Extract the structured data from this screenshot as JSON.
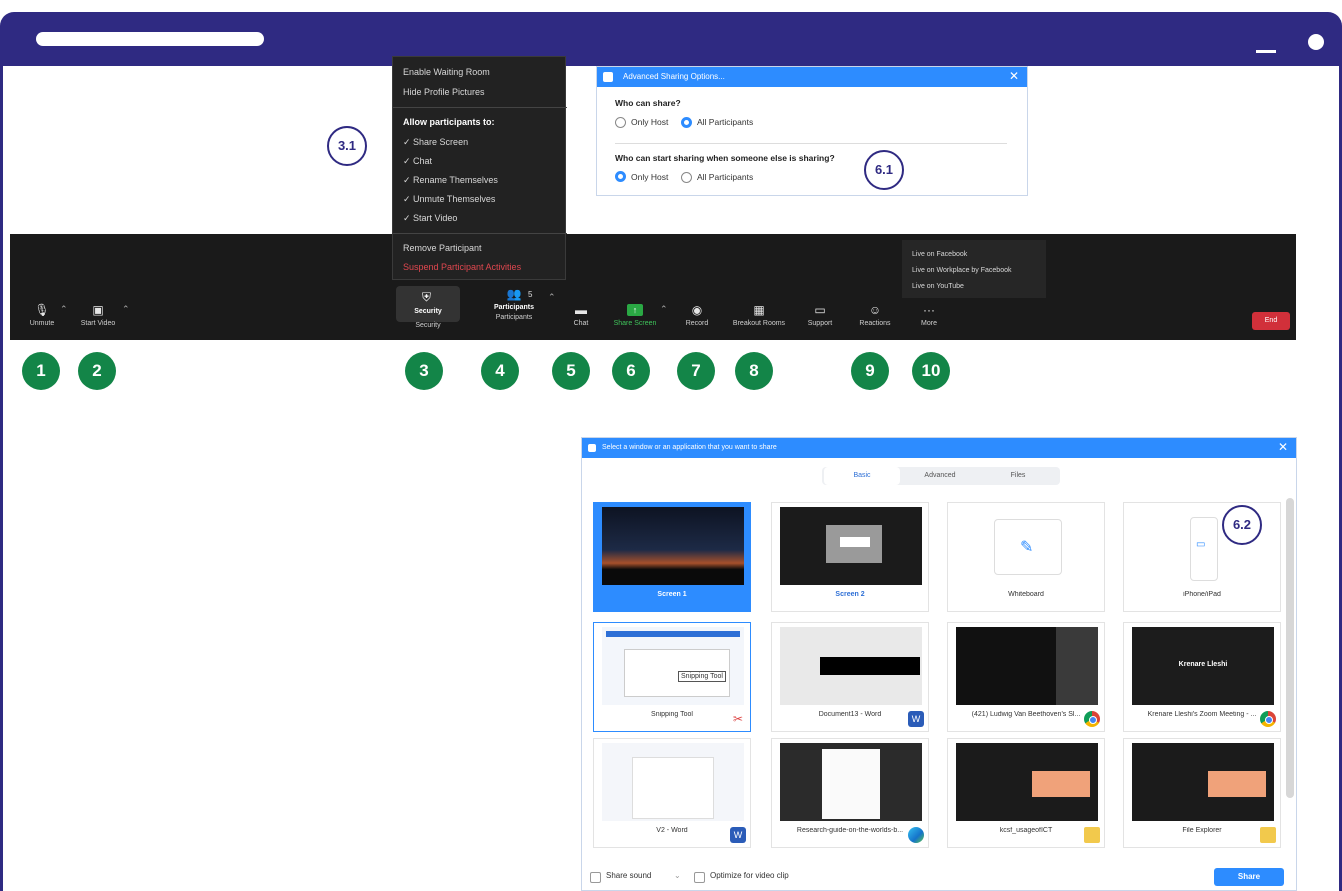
{
  "colors": {
    "frame": "#2f2a82",
    "callout_green": "#138548",
    "zoom_blue": "#2d8cff",
    "toolbar_bg": "#1a1a1a",
    "end_red": "#d1303a"
  },
  "window": {
    "minimize_icon": "minimize-icon",
    "maximize_icon": "circle-icon"
  },
  "security_menu": {
    "items": [
      "Enable Waiting Room",
      "Hide Profile Pictures"
    ],
    "allow_heading": "Allow participants to:",
    "allow_items": [
      "✓ Share Screen",
      "✓ Chat",
      "✓ Rename Themselves",
      "✓ Unmute Themselves",
      "✓ Start Video"
    ],
    "remove": "Remove Participant",
    "suspend": "Suspend Participant Activities"
  },
  "advanced_sharing": {
    "title": "Advanced Sharing Options...",
    "close": "✕",
    "q1": "Who can share?",
    "q2": "Who can start sharing when someone else is sharing?",
    "only_host": "Only Host",
    "all_participants": "All Participants",
    "q1_selected": "All Participants",
    "q2_selected": "Only Host"
  },
  "toolbar": {
    "unmute": "Unmute",
    "start_video": "Start Video",
    "security": "Security",
    "security_highlight": "Security",
    "participants": "Participants",
    "participants_highlight": "Participants",
    "participants_count": "5",
    "chat": "Chat",
    "share_screen": "Share Screen",
    "record": "Record",
    "breakout_rooms": "Breakout Rooms",
    "support": "Support",
    "reactions": "Reactions",
    "more": "More",
    "end": "End"
  },
  "more_menu": {
    "items": [
      "Live on Facebook",
      "Live on Workplace by Facebook",
      "Live on YouTube"
    ]
  },
  "callouts": {
    "numbers": [
      "1",
      "2",
      "3",
      "4",
      "5",
      "6",
      "7",
      "8",
      "9",
      "10"
    ],
    "c31": "3.1",
    "c61": "6.1",
    "c62": "6.2"
  },
  "share_dialog": {
    "title": "Select a window or an application that you want to share",
    "close": "✕",
    "tabs": [
      "Basic",
      "Advanced",
      "Files"
    ],
    "tiles": [
      {
        "label": "Screen 1"
      },
      {
        "label": "Screen 2"
      },
      {
        "label": "Whiteboard"
      },
      {
        "label": "iPhone/iPad"
      },
      {
        "label": "Snipping Tool"
      },
      {
        "label": "Document13 - Word"
      },
      {
        "label": "(421) Ludwig Van Beethoven's Sl..."
      },
      {
        "label": "Krenare Lleshi's Zoom Meeting - ..."
      },
      {
        "label": "V2 - Word"
      },
      {
        "label": "Research-guide-on-the-worlds-b..."
      },
      {
        "label": "kcsf_usageofICT"
      },
      {
        "label": "File Explorer"
      }
    ],
    "snip_tooltip": "Snipping Tool",
    "meeting_name": "Krenare Lleshi",
    "share_sound": "Share sound",
    "optimize": "Optimize for video clip",
    "share_button": "Share"
  }
}
